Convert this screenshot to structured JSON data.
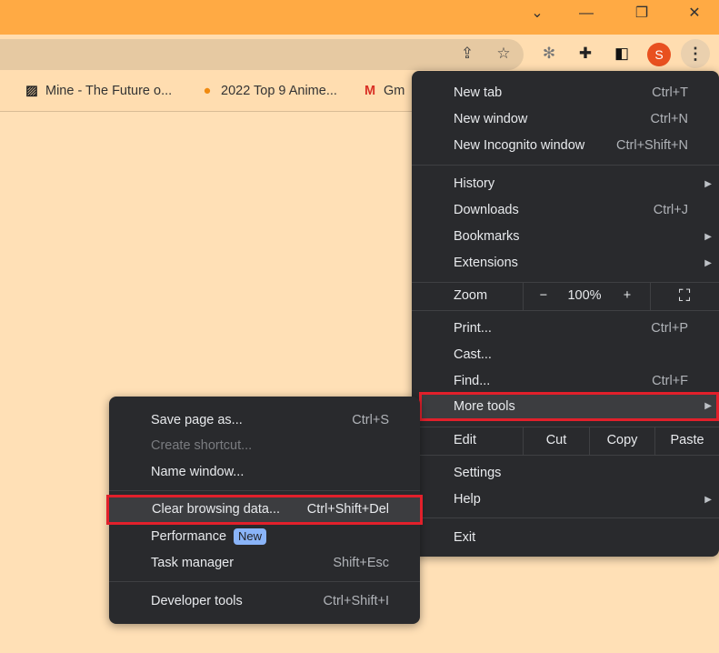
{
  "titlebar": {
    "tab_search": "⌄",
    "minimize": "—",
    "restore": "❐",
    "close": "✕"
  },
  "toolbar": {
    "share_icon": "⇪",
    "star_icon": "☆",
    "extension_icon": "✻",
    "puzzle_icon": "✚",
    "sidepanel_icon": "◧",
    "avatar": "S",
    "menu_icon": "⋮"
  },
  "bookmarks": [
    {
      "label": "Mine - The Future o...",
      "icon": "▨",
      "color": "#222"
    },
    {
      "label": "2022 Top 9 Anime...",
      "icon": "●",
      "color": "#F08A10"
    },
    {
      "label": "Gm",
      "icon": "M",
      "color": "#D93025"
    }
  ],
  "menu": {
    "new_tab": {
      "label": "New tab",
      "shortcut": "Ctrl+T"
    },
    "new_window": {
      "label": "New window",
      "shortcut": "Ctrl+N"
    },
    "incognito": {
      "label": "New Incognito window",
      "shortcut": "Ctrl+Shift+N"
    },
    "history": {
      "label": "History"
    },
    "downloads": {
      "label": "Downloads",
      "shortcut": "Ctrl+J"
    },
    "bookmarks": {
      "label": "Bookmarks"
    },
    "extensions": {
      "label": "Extensions"
    },
    "zoom": {
      "label": "Zoom",
      "minus": "−",
      "value": "100%",
      "plus": "+",
      "fullscreen": "⛶"
    },
    "print": {
      "label": "Print...",
      "shortcut": "Ctrl+P"
    },
    "cast": {
      "label": "Cast..."
    },
    "find": {
      "label": "Find...",
      "shortcut": "Ctrl+F"
    },
    "more_tools": {
      "label": "More tools"
    },
    "edit": {
      "label": "Edit",
      "cut": "Cut",
      "copy": "Copy",
      "paste": "Paste"
    },
    "settings": {
      "label": "Settings"
    },
    "help": {
      "label": "Help"
    },
    "exit": {
      "label": "Exit"
    },
    "arrow": "▶"
  },
  "submenu": {
    "save_page": {
      "label": "Save page as...",
      "shortcut": "Ctrl+S"
    },
    "create_shortcut": {
      "label": "Create shortcut..."
    },
    "name_window": {
      "label": "Name window..."
    },
    "clear_data": {
      "label": "Clear browsing data...",
      "shortcut": "Ctrl+Shift+Del"
    },
    "performance": {
      "label": "Performance",
      "badge": "New"
    },
    "task_manager": {
      "label": "Task manager",
      "shortcut": "Shift+Esc"
    },
    "dev_tools": {
      "label": "Developer tools",
      "shortcut": "Ctrl+Shift+I"
    }
  }
}
